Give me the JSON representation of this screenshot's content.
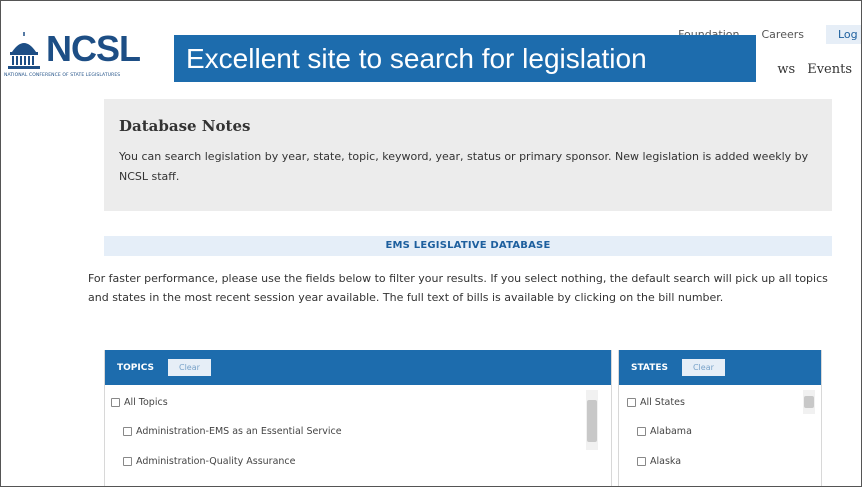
{
  "header": {
    "brand": "NCSL",
    "tagline": "NATIONAL CONFERENCE OF STATE LEGISLATURES",
    "top_links": [
      "Foundation",
      "Careers",
      "Log"
    ],
    "nav": [
      "ws",
      "Events"
    ]
  },
  "banner": {
    "text": "Excellent site to search for legislation"
  },
  "notes": {
    "title": "Database Notes",
    "body": "You can search legislation by year, state, topic, keyword, year, status or primary sponsor. New legislation is added weekly by NCSL staff."
  },
  "database": {
    "title": "EMS LEGISLATIVE DATABASE",
    "performance_note": "For faster performance, please use the fields below to filter your results. If you select nothing, the default search will pick up all topics and states in the most recent session year available. The full text of bills is available by clicking on the bill number."
  },
  "topics": {
    "label": "TOPICS",
    "clear_label": "Clear",
    "all_label": "All Topics",
    "items": [
      "Administration-EMS as an Essential Service",
      "Administration-Quality Assurance"
    ]
  },
  "states": {
    "label": "STATES",
    "clear_label": "Clear",
    "all_label": "All States",
    "items": [
      "Alabama",
      "Alaska"
    ]
  },
  "colors": {
    "brand_blue": "#1d4e85",
    "banner_blue": "#1d6cad",
    "notes_bg": "#ececec",
    "db_title_bg": "#e5eef8"
  }
}
